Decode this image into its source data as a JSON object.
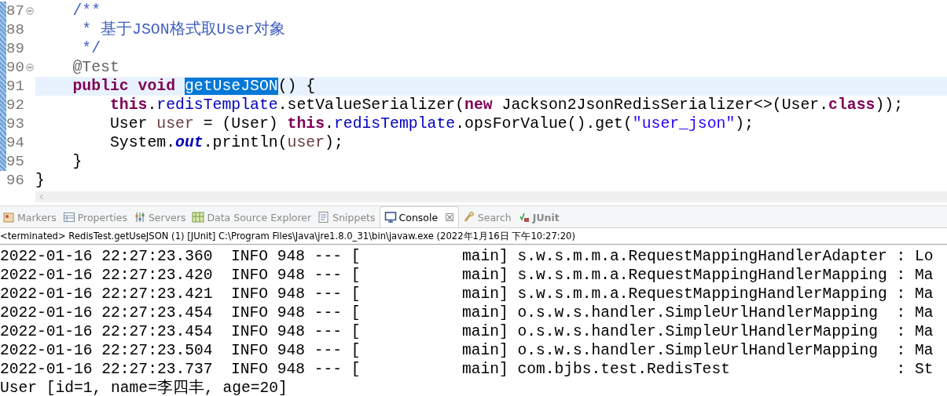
{
  "editor": {
    "lines": [
      {
        "number": "87",
        "fold": true,
        "changed": true,
        "current": false,
        "tokens": [
          {
            "kind": "comment",
            "text": "    /**"
          }
        ]
      },
      {
        "number": "88",
        "fold": false,
        "changed": true,
        "current": false,
        "tokens": [
          {
            "kind": "comment",
            "text": "     * 基于JSON格式取User对象"
          }
        ]
      },
      {
        "number": "89",
        "fold": false,
        "changed": true,
        "current": false,
        "tokens": [
          {
            "kind": "comment",
            "text": "     */"
          }
        ]
      },
      {
        "number": "90",
        "fold": true,
        "changed": true,
        "current": false,
        "tokens": [
          {
            "kind": "annotation",
            "text": "    @Test"
          }
        ]
      },
      {
        "number": "91",
        "fold": false,
        "changed": true,
        "current": true,
        "tokens": [
          {
            "kind": "keyword",
            "text": "    public void "
          },
          {
            "kind": "selected",
            "text": "getUseJSON"
          },
          {
            "kind": "plain",
            "text": "() {"
          }
        ]
      },
      {
        "number": "92",
        "fold": false,
        "changed": true,
        "current": false,
        "tokens": [
          {
            "kind": "keyword",
            "text": "        this"
          },
          {
            "kind": "plain",
            "text": "."
          },
          {
            "kind": "field",
            "text": "redisTemplate"
          },
          {
            "kind": "plain",
            "text": ".setValueSerializer("
          },
          {
            "kind": "keyword",
            "text": "new"
          },
          {
            "kind": "plain",
            "text": " Jackson2JsonRedisSerializer<>(User."
          },
          {
            "kind": "keyword",
            "text": "class"
          },
          {
            "kind": "plain",
            "text": "));"
          }
        ]
      },
      {
        "number": "93",
        "fold": false,
        "changed": true,
        "current": false,
        "tokens": [
          {
            "kind": "plain",
            "text": "        User "
          },
          {
            "kind": "local",
            "text": "user"
          },
          {
            "kind": "plain",
            "text": " = (User) "
          },
          {
            "kind": "keyword",
            "text": "this"
          },
          {
            "kind": "plain",
            "text": "."
          },
          {
            "kind": "field",
            "text": "redisTemplate"
          },
          {
            "kind": "plain",
            "text": ".opsForValue().get("
          },
          {
            "kind": "string",
            "text": "\"user_json\""
          },
          {
            "kind": "plain",
            "text": ");"
          }
        ]
      },
      {
        "number": "94",
        "fold": false,
        "changed": true,
        "current": false,
        "tokens": [
          {
            "kind": "plain",
            "text": "        System."
          },
          {
            "kind": "static",
            "text": "out"
          },
          {
            "kind": "plain",
            "text": ".println("
          },
          {
            "kind": "local",
            "text": "user"
          },
          {
            "kind": "plain",
            "text": ");"
          }
        ]
      },
      {
        "number": "95",
        "fold": false,
        "changed": true,
        "current": false,
        "tokens": [
          {
            "kind": "plain",
            "text": "    }"
          }
        ]
      },
      {
        "number": "96",
        "fold": false,
        "changed": false,
        "current": false,
        "tokens": [
          {
            "kind": "plain",
            "text": "}"
          }
        ]
      }
    ]
  },
  "views": {
    "tabs": [
      {
        "label": "Markers",
        "selected": false,
        "emphasized": false
      },
      {
        "label": "Properties",
        "selected": false,
        "emphasized": false
      },
      {
        "label": "Servers",
        "selected": false,
        "emphasized": false
      },
      {
        "label": "Data Source Explorer",
        "selected": false,
        "emphasized": false
      },
      {
        "label": "Snippets",
        "selected": false,
        "emphasized": false
      },
      {
        "label": "Console",
        "selected": true,
        "emphasized": false,
        "close": "☒"
      },
      {
        "label": "Search",
        "selected": false,
        "emphasized": false
      },
      {
        "label": "JUnit",
        "selected": false,
        "emphasized": true
      }
    ]
  },
  "console": {
    "header": "<terminated> RedisTest.getUseJSON (1) [JUnit] C:\\Program Files\\Java\\jre1.8.0_31\\bin\\javaw.exe (2022年1月16日 下午10:27:20)",
    "lines": [
      "2022-01-16 22:27:23.360  INFO 948 --- [           main] s.w.s.m.m.a.RequestMappingHandlerAdapter : Lo",
      "2022-01-16 22:27:23.420  INFO 948 --- [           main] s.w.s.m.m.a.RequestMappingHandlerMapping : Ma",
      "2022-01-16 22:27:23.421  INFO 948 --- [           main] s.w.s.m.m.a.RequestMappingHandlerMapping : Ma",
      "2022-01-16 22:27:23.454  INFO 948 --- [           main] o.s.w.s.handler.SimpleUrlHandlerMapping  : Ma",
      "2022-01-16 22:27:23.454  INFO 948 --- [           main] o.s.w.s.handler.SimpleUrlHandlerMapping  : Ma",
      "2022-01-16 22:27:23.504  INFO 948 --- [           main] o.s.w.s.handler.SimpleUrlHandlerMapping  : Ma",
      "2022-01-16 22:27:23.737  INFO 948 --- [           main] com.bjbs.test.RedisTest                  : St",
      "User [id=1, name=李四丰, age=20]"
    ]
  }
}
